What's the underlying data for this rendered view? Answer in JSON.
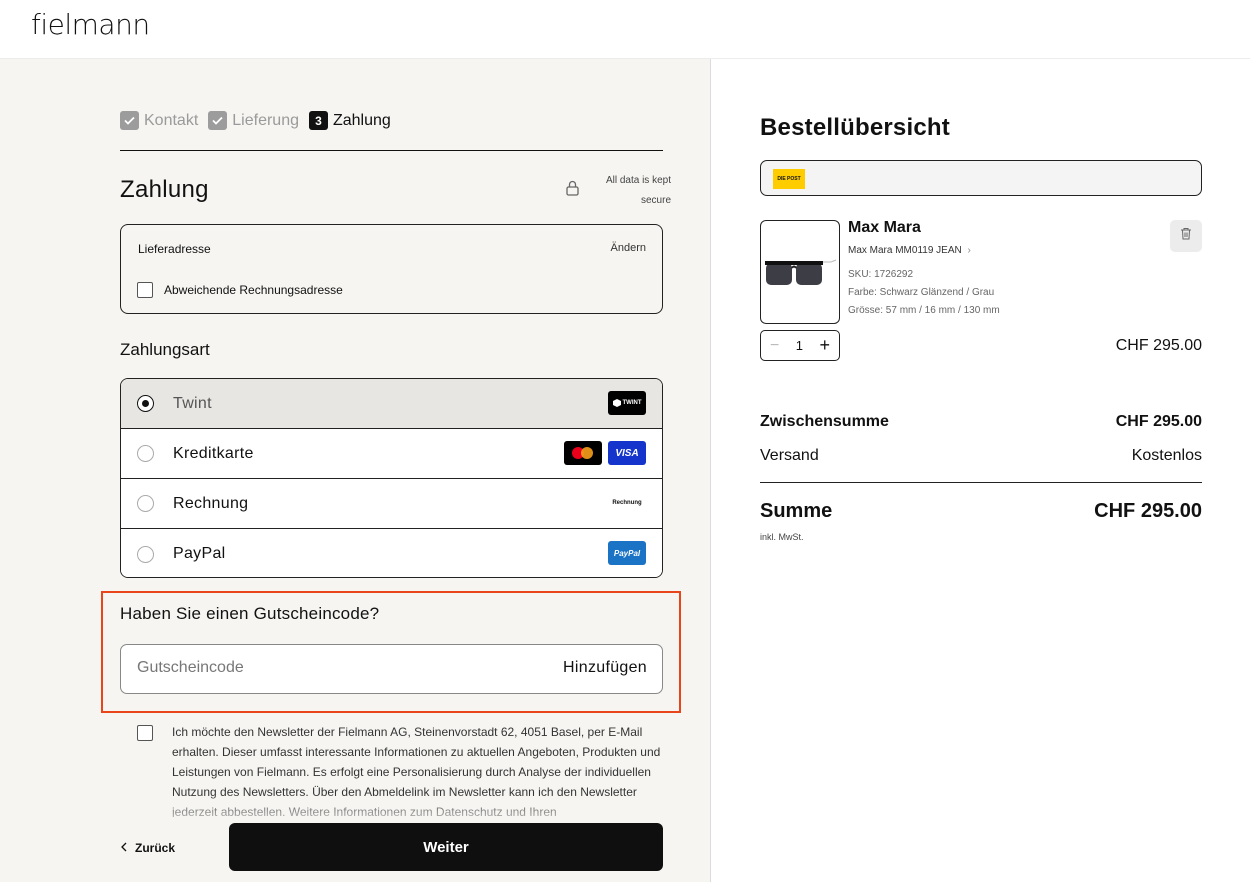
{
  "brand": {
    "logo": "fielmann"
  },
  "steps": [
    {
      "label": "Kontakt",
      "state": "done"
    },
    {
      "label": "Lieferung",
      "state": "done"
    },
    {
      "number": "3",
      "label": "Zahlung",
      "state": "active"
    }
  ],
  "payment": {
    "title": "Zahlung",
    "secure_line1": "All data is kept",
    "secure_line2": "secure",
    "address": {
      "label": "Lieferadresse",
      "change_label": "Ändern",
      "billing_checkbox_label": "Abweichende Rechnungsadresse",
      "billing_checked": false
    },
    "method_title": "Zahlungsart",
    "methods": [
      {
        "label": "Twint",
        "selected": true,
        "icons": [
          "twint-icon"
        ],
        "badge_text": "TWINT"
      },
      {
        "label": "Kreditkarte",
        "selected": false,
        "icons": [
          "mastercard-icon",
          "visa-icon"
        ],
        "badge_text": "VISA"
      },
      {
        "label": "Rechnung",
        "selected": false,
        "icons": [
          "invoice-icon"
        ],
        "badge_text": "Rechnung"
      },
      {
        "label": "PayPal",
        "selected": false,
        "icons": [
          "paypal-icon"
        ],
        "badge_text": "PayPal"
      }
    ],
    "voucher": {
      "title": "Haben Sie einen Gutscheincode?",
      "placeholder": "Gutscheincode",
      "add_label": "Hinzufügen"
    },
    "newsletter": {
      "checked": false,
      "text": "Ich möchte den Newsletter der Fielmann AG, Steinenvorstadt 62, 4051 Basel, per E-Mail erhalten. Dieser umfasst interessante Informationen zu aktuellen Angeboten, Produkten und Leistungen von Fielmann. Es erfolgt eine Personalisierung durch Analyse der individuellen Nutzung des Newsletters. Über den Abmeldelink im Newsletter kann ich den Newsletter jederzeit abbestellen. Weitere Informationen zum Datenschutz und Ihren"
    },
    "back_label": "Zurück",
    "next_label": "Weiter"
  },
  "summary": {
    "title": "Bestellübersicht",
    "post_logo": "DIE POST",
    "product": {
      "brand": "Max Mara",
      "name": "Max Mara MM0119 JEAN",
      "sku": "SKU: 1726292",
      "color": "Farbe: Schwarz Glänzend / Grau",
      "size": "Grösse: 57 mm / 16 mm / 130 mm",
      "quantity": "1",
      "price": "CHF 295.00"
    },
    "subtotal_label": "Zwischensumme",
    "subtotal_value": "CHF 295.00",
    "shipping_label": "Versand",
    "shipping_value": "Kostenlos",
    "total_label": "Summe",
    "total_value": "CHF 295.00",
    "vat_note": "inkl. MwSt."
  },
  "colors": {
    "accent_highlight": "#e8451b",
    "primary_button": "#0f0f0f",
    "left_panel_bg": "#f6f5f2"
  }
}
